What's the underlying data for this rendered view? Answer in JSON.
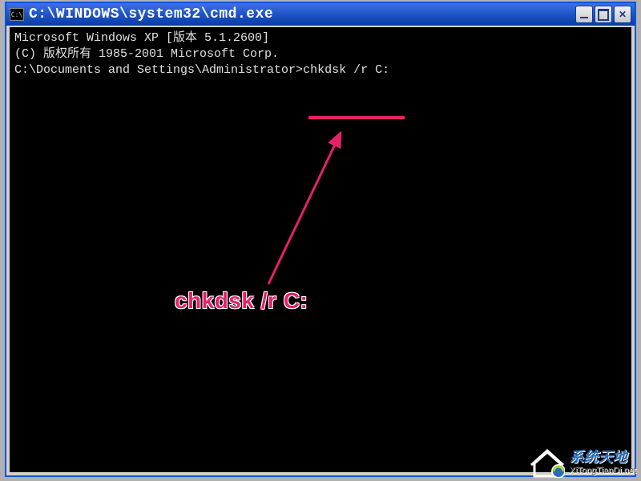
{
  "window": {
    "title": "C:\\WINDOWS\\system32\\cmd.exe",
    "icon_label": "C:\\"
  },
  "terminal": {
    "line1": "Microsoft Windows XP [版本 5.1.2600]",
    "line2": "(C) 版权所有 1985-2001 Microsoft Corp.",
    "blank": "",
    "prompt": "C:\\Documents and Settings\\Administrator>",
    "command": "chkdsk /r C:"
  },
  "annotation": {
    "callout_text": "chkdsk /r C:",
    "underline_color": "#e8206a"
  },
  "watermark": {
    "name_cn": "系统天地",
    "name_en": "XiTongTianDi.net"
  }
}
